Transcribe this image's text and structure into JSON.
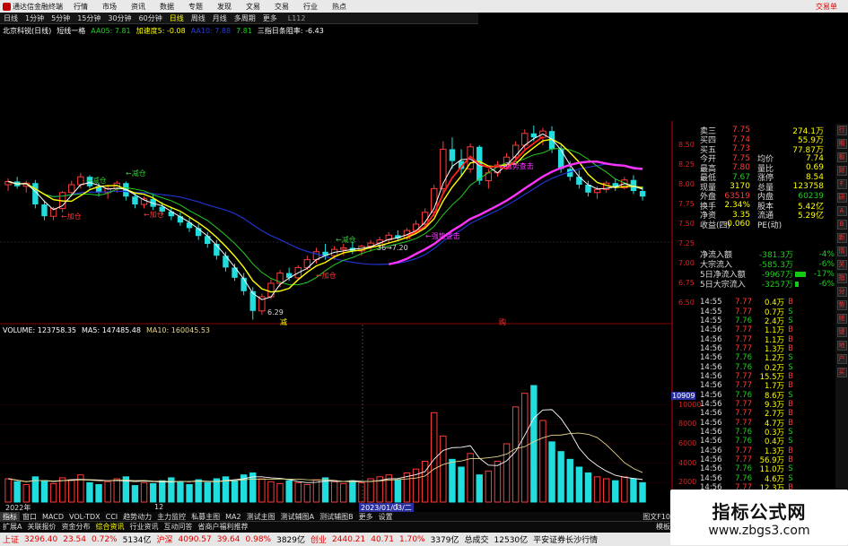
{
  "app": {
    "title": "通达信金融终端",
    "menu": [
      "行情",
      "市场",
      "资讯",
      "数据",
      "专题",
      "发现",
      "文易",
      "交易",
      "行业",
      "热点"
    ],
    "trade_action": "交易单"
  },
  "periods": {
    "items": [
      "日线",
      "1分钟",
      "5分钟",
      "15分钟",
      "30分钟",
      "60分钟",
      "日线",
      "周线",
      "月线",
      "多周期",
      "更多"
    ],
    "selected_index": 6,
    "version": "L112"
  },
  "indicator_line": {
    "stock_name": "北京科锐(日线)",
    "formula": "短线一格",
    "aa": "AA05: 7.81",
    "accel": "加速度5: -0.08",
    "aa10": "AA10: 7.88",
    "val": "7.81",
    "three": "三指日条阻率: -6.43"
  },
  "volume_line": {
    "volume": "VOLUME: 123758.35",
    "ma5": "MA5: 147485.48",
    "ma10": "MA10: 160045.53"
  },
  "chart_annotations": {
    "reduce1": "←减仓",
    "add1": "←加仓",
    "reduce2": "←减仓",
    "add2": "←加仓",
    "add3": "←加仓",
    "reduce3": "←减仓",
    "strong1": "←强势查击",
    "strong2": "←强势查击",
    "low_value": "6.29",
    "mid_value": "36→7.20",
    "marker1": "减",
    "marker2": "购",
    "cursor_date": "2023/01/03/二",
    "date_start": "2022年",
    "tick_12": "12",
    "tick_1": "1"
  },
  "chart_data": {
    "type": "candlestick",
    "price_ticks": [
      "8.50",
      "8.25",
      "8.00",
      "7.75",
      "7.50",
      "7.25",
      "7.00",
      "6.75",
      "6.50"
    ],
    "price_range": [
      6.25,
      8.75
    ],
    "volume_ticks": [
      "10000",
      "8000",
      "6000",
      "4000",
      "2000"
    ],
    "volume_range": [
      0,
      12000
    ],
    "volume_cursor": "10909",
    "candles": [
      [
        8.0,
        8.08,
        7.92,
        8.04
      ],
      [
        8.04,
        8.1,
        7.95,
        7.98
      ],
      [
        7.98,
        8.05,
        7.9,
        8.02
      ],
      [
        8.02,
        8.06,
        7.7,
        7.75
      ],
      [
        7.75,
        7.8,
        7.55,
        7.6
      ],
      [
        7.6,
        7.72,
        7.55,
        7.7
      ],
      [
        7.7,
        7.92,
        7.65,
        7.9
      ],
      [
        7.9,
        8.05,
        7.85,
        8.0
      ],
      [
        8.0,
        8.15,
        7.95,
        8.1
      ],
      [
        8.1,
        8.12,
        7.95,
        7.98
      ],
      [
        7.98,
        8.02,
        7.85,
        7.9
      ],
      [
        7.9,
        8.0,
        7.82,
        7.95
      ],
      [
        7.95,
        8.05,
        7.9,
        8.02
      ],
      [
        8.02,
        8.04,
        7.8,
        7.85
      ],
      [
        7.85,
        7.9,
        7.7,
        7.75
      ],
      [
        7.75,
        7.85,
        7.7,
        7.82
      ],
      [
        7.82,
        7.88,
        7.68,
        7.72
      ],
      [
        7.72,
        7.78,
        7.62,
        7.66
      ],
      [
        7.66,
        7.72,
        7.55,
        7.6
      ],
      [
        7.6,
        7.65,
        7.48,
        7.52
      ],
      [
        7.52,
        7.58,
        7.4,
        7.45
      ],
      [
        7.45,
        7.5,
        7.3,
        7.35
      ],
      [
        7.35,
        7.4,
        7.2,
        7.25
      ],
      [
        7.25,
        7.3,
        7.05,
        7.1
      ],
      [
        7.1,
        7.15,
        6.9,
        6.95
      ],
      [
        6.95,
        7.0,
        6.78,
        6.82
      ],
      [
        6.82,
        6.88,
        6.6,
        6.65
      ],
      [
        6.65,
        6.7,
        6.29,
        6.4
      ],
      [
        6.4,
        6.62,
        6.35,
        6.58
      ],
      [
        6.58,
        6.8,
        6.55,
        6.75
      ],
      [
        6.75,
        6.92,
        6.7,
        6.88
      ],
      [
        6.88,
        6.95,
        6.78,
        6.82
      ],
      [
        6.82,
        6.98,
        6.8,
        6.95
      ],
      [
        6.95,
        7.1,
        6.92,
        7.05
      ],
      [
        7.05,
        7.2,
        7.0,
        7.15
      ],
      [
        7.15,
        7.25,
        7.05,
        7.1
      ],
      [
        7.1,
        7.22,
        7.05,
        7.18
      ],
      [
        7.18,
        7.25,
        7.1,
        7.2
      ],
      [
        7.2,
        7.28,
        7.12,
        7.16
      ],
      [
        7.16,
        7.24,
        7.1,
        7.22
      ],
      [
        7.22,
        7.3,
        7.15,
        7.26
      ],
      [
        7.26,
        7.34,
        7.2,
        7.3
      ],
      [
        7.3,
        7.4,
        7.25,
        7.36
      ],
      [
        7.36,
        7.42,
        7.28,
        7.32
      ],
      [
        7.32,
        7.45,
        7.3,
        7.42
      ],
      [
        7.42,
        7.55,
        7.38,
        7.5
      ],
      [
        7.5,
        7.7,
        7.45,
        7.65
      ],
      [
        7.65,
        8.0,
        7.6,
        7.95
      ],
      [
        7.95,
        8.55,
        7.9,
        8.45
      ],
      [
        8.45,
        8.6,
        8.2,
        8.3
      ],
      [
        8.3,
        8.45,
        8.1,
        8.2
      ],
      [
        8.2,
        8.52,
        8.15,
        8.48
      ],
      [
        8.48,
        8.5,
        8.0,
        8.05
      ],
      [
        8.05,
        8.2,
        7.95,
        8.15
      ],
      [
        8.15,
        8.3,
        8.1,
        8.25
      ],
      [
        8.25,
        8.4,
        8.2,
        8.35
      ],
      [
        8.35,
        8.55,
        8.3,
        8.5
      ],
      [
        8.5,
        8.7,
        8.45,
        8.65
      ],
      [
        8.65,
        8.75,
        8.55,
        8.6
      ],
      [
        8.6,
        8.72,
        8.5,
        8.68
      ],
      [
        8.68,
        8.74,
        8.4,
        8.45
      ],
      [
        8.45,
        8.5,
        8.15,
        8.2
      ],
      [
        8.2,
        8.3,
        8.05,
        8.1
      ],
      [
        8.1,
        8.18,
        7.95,
        8.0
      ],
      [
        8.0,
        8.05,
        7.85,
        7.9
      ],
      [
        7.9,
        7.98,
        7.82,
        7.94
      ],
      [
        7.94,
        8.05,
        7.9,
        8.02
      ],
      [
        8.02,
        8.08,
        7.92,
        7.96
      ],
      [
        7.96,
        8.1,
        7.94,
        8.06
      ],
      [
        8.06,
        8.12,
        7.88,
        7.92
      ],
      [
        7.92,
        7.98,
        7.8,
        7.85
      ]
    ],
    "volumes": [
      2400,
      2100,
      1800,
      2600,
      2200,
      1900,
      2500,
      2300,
      2800,
      2000,
      1800,
      2100,
      2400,
      2600,
      1700,
      2000,
      1900,
      2200,
      2500,
      2100,
      1800,
      2300,
      2000,
      2400,
      2600,
      2200,
      2800,
      3000,
      2400,
      2100,
      1900,
      2200,
      2000,
      1800,
      2300,
      2500,
      2100,
      1900,
      2200,
      2000,
      2400,
      2600,
      2800,
      2300,
      3000,
      3400,
      4200,
      9200,
      6800,
      4400,
      3600,
      5000,
      2800,
      3200,
      4200,
      6000,
      9800,
      11200,
      12000,
      8400,
      6200,
      5200,
      4400,
      3600,
      3000,
      2600,
      2400,
      2200,
      2600,
      2400,
      2000
    ]
  },
  "quote": {
    "rows": [
      {
        "l1": "卖三",
        "v1": "7.75",
        "l2": "",
        "v2": "274.1万"
      },
      {
        "l1": "买四",
        "v1": "7.74",
        "l2": "",
        "v2": "55.9万"
      },
      {
        "l1": "买五",
        "v1": "7.73",
        "l2": "",
        "v2": "77.87万"
      },
      {
        "l1": "今开",
        "v1": "7.75",
        "l2": "均价",
        "v2": "7.74"
      },
      {
        "l1": "最高",
        "v1": "7.80",
        "l2": "量比",
        "v2": "0.69"
      },
      {
        "l1": "最低",
        "v1": "7.67",
        "l2": "涨停",
        "v2": "8.54"
      },
      {
        "l1": "现量",
        "v1": "3170",
        "l2": "总量",
        "v2": "123758"
      },
      {
        "l1": "外盘",
        "v1": "63519",
        "l2": "内盘",
        "v2": "60239"
      },
      {
        "l1": "换手",
        "v1": "2.34%",
        "l2": "股本",
        "v2": "5.42亿"
      },
      {
        "l1": "净资",
        "v1": "3.35",
        "l2": "流通",
        "v2": "5.29亿"
      },
      {
        "l1": "收益(四)",
        "v1": "-0.060",
        "l2": "PE(动)",
        "v2": ""
      }
    ]
  },
  "flow": {
    "rows": [
      {
        "label": "净流入额",
        "value": "-381.3万",
        "pct": "-4%",
        "bar": 0
      },
      {
        "label": "大宗流入",
        "value": "-585.3万",
        "pct": "-6%",
        "bar": 0
      },
      {
        "label": "5日净流入额",
        "value": "-9967万",
        "pct": "-17%",
        "bar": 12
      },
      {
        "label": "5日大宗流入",
        "value": "-3257万",
        "pct": "-6%",
        "bar": 4
      }
    ]
  },
  "ticks": {
    "rows": [
      {
        "t": "14:55",
        "p": "7.77",
        "v": "0.4万",
        "bs": "B"
      },
      {
        "t": "14:55",
        "p": "7.77",
        "v": "0.7万",
        "bs": "S"
      },
      {
        "t": "14:55",
        "p": "7.76",
        "v": "2.4万",
        "bs": "S"
      },
      {
        "t": "14:56",
        "p": "7.77",
        "v": "1.1万",
        "bs": "B"
      },
      {
        "t": "14:56",
        "p": "7.77",
        "v": "1.1万",
        "bs": "B"
      },
      {
        "t": "14:56",
        "p": "7.77",
        "v": "1.3万",
        "bs": "B"
      },
      {
        "t": "14:56",
        "p": "7.76",
        "v": "1.2万",
        "bs": "S"
      },
      {
        "t": "14:56",
        "p": "7.76",
        "v": "0.2万",
        "bs": "S"
      },
      {
        "t": "14:56",
        "p": "7.77",
        "v": "15.5万",
        "bs": "B"
      },
      {
        "t": "14:56",
        "p": "7.77",
        "v": "1.7万",
        "bs": "B"
      },
      {
        "t": "14:56",
        "p": "7.76",
        "v": "8.6万",
        "bs": "S"
      },
      {
        "t": "14:56",
        "p": "7.77",
        "v": "9.3万",
        "bs": "B"
      },
      {
        "t": "14:56",
        "p": "7.77",
        "v": "2.7万",
        "bs": "B"
      },
      {
        "t": "14:56",
        "p": "7.77",
        "v": "4.7万",
        "bs": "B"
      },
      {
        "t": "14:56",
        "p": "7.76",
        "v": "0.3万",
        "bs": "S"
      },
      {
        "t": "14:56",
        "p": "7.76",
        "v": "0.4万",
        "bs": "S"
      },
      {
        "t": "14:56",
        "p": "7.77",
        "v": "1.3万",
        "bs": "B"
      },
      {
        "t": "14:56",
        "p": "7.77",
        "v": "56.9万",
        "bs": "B"
      },
      {
        "t": "14:56",
        "p": "7.76",
        "v": "11.0万",
        "bs": "S"
      },
      {
        "t": "14:56",
        "p": "7.76",
        "v": "4.6万",
        "bs": "S"
      },
      {
        "t": "14:56",
        "p": "7.77",
        "v": "12.3万",
        "bs": "B"
      }
    ]
  },
  "side_tools": [
    "行",
    "期",
    "板",
    "财",
    "F",
    "研",
    "A",
    "B",
    "新",
    "情",
    "关",
    "指",
    "分",
    "势",
    "统",
    "键",
    "地",
    "户",
    "买"
  ],
  "tabs1": {
    "items": [
      "指标",
      "窗口",
      "MACD",
      "VOL-TDX",
      "CCI",
      "趋势动力",
      "主力监控",
      "私募主图",
      "MA2",
      "测试主图",
      "测试辅图A",
      "测试辅图B",
      "更多",
      "设置"
    ],
    "right": "图文F10"
  },
  "tabs2": {
    "items": [
      "扩展A",
      "关联报价",
      "资金分布",
      "综合资讯",
      "行业资讯",
      "互动问答",
      "省商户福利推荐"
    ],
    "selected_index": 3,
    "right": "模板"
  },
  "status": {
    "sh_label": "上证",
    "sh_value": "3296.40",
    "sh_change": "23.54",
    "sh_pct": "0.72%",
    "sh_amount": "5134亿",
    "sz_label": "沪深",
    "sz_value": "4090.57",
    "sz_change": "39.64",
    "sz_pct": "0.98%",
    "sz_amount": "3829亿",
    "cy_label": "创业",
    "cy_value": "2440.21",
    "cy_change": "40.71",
    "cy_pct": "1.70%",
    "cy_amount": "3379亿",
    "total_label": "总成交",
    "total_value": "12530亿",
    "broker": "平安证券长沙行情"
  },
  "watermark": {
    "title": "指标公式网",
    "url": "www.zbgs3.com"
  },
  "colors": {
    "up": "#ff3b3b",
    "down": "#22dddd",
    "ma_short": "#ffffff",
    "ma_mid": "#ffff00",
    "ma_green": "#22cc22",
    "ma_blue": "#2233cc",
    "ma_magenta": "#ff33ff",
    "vol_ma5": "#ffffff",
    "vol_ma10": "#e6d48a"
  }
}
